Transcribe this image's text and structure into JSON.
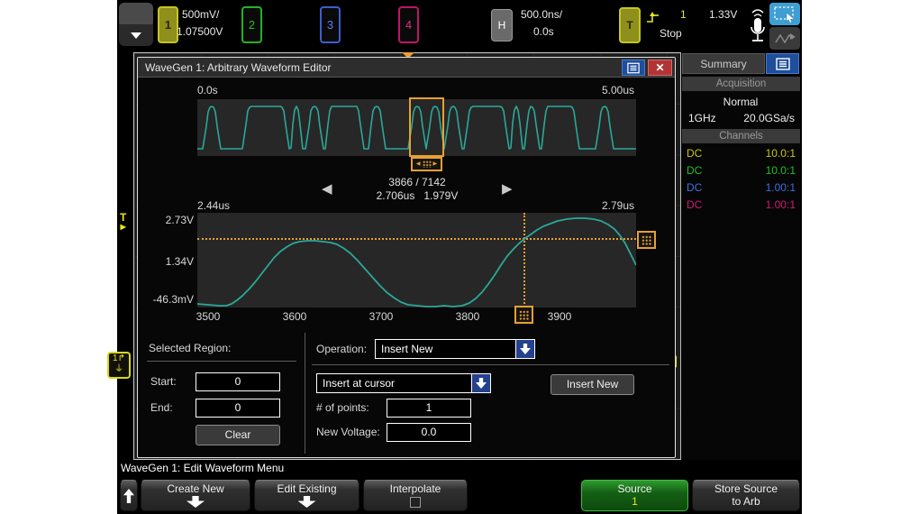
{
  "top_bar": {
    "ch1_label": "1",
    "ch1_scale": "500mV/",
    "ch1_offset": "1.07500V",
    "ch2_label": "2",
    "ch3_label": "3",
    "ch4_label": "4",
    "h_label": "H",
    "h_scale": "500.0ns/",
    "h_delay": "0.0s",
    "t_label": "T",
    "trigger_source": "1",
    "run_state": "Stop",
    "trigger_level": "1.33V"
  },
  "dialog": {
    "title": "WaveGen 1: Arbitrary Waveform Editor",
    "close_label": "✕",
    "overview": {
      "start_label": "0.0s",
      "end_label": "5.00us"
    },
    "nav": {
      "position": "3866 / 7142",
      "time": "2.706us",
      "voltage": "1.979V",
      "prev": "◀",
      "next": "▶"
    },
    "zoom": {
      "start_label": "2.44us",
      "end_label": "2.79us",
      "y_ticks": [
        "2.73V",
        "1.34V",
        "-46.3mV"
      ],
      "x_ticks": [
        "3500",
        "3600",
        "3700",
        "3800",
        "3900"
      ]
    },
    "region": {
      "heading": "Selected Region:",
      "start_label": "Start:",
      "start_value": "0",
      "end_label": "End:",
      "end_value": "0",
      "clear_label": "Clear"
    },
    "op": {
      "label": "Operation:",
      "value": "Insert New",
      "mode_value": "Insert at cursor",
      "points_label": "# of points:",
      "points_value": "1",
      "voltage_label": "New Voltage:",
      "voltage_value": "0.0",
      "action_label": "Insert New"
    }
  },
  "sidebar": {
    "tab": "Summary",
    "acq_header": "Acquisition",
    "acq_mode": "Normal",
    "bandwidth": "1GHz",
    "sample_rate": "20.0GSa/s",
    "ch_header": "Channels",
    "channels": [
      {
        "coupling": "DC",
        "probe": "10.0:1",
        "color": "#c8c814"
      },
      {
        "coupling": "DC",
        "probe": "10.0:1",
        "color": "#22c022"
      },
      {
        "coupling": "DC",
        "probe": "1.00:1",
        "color": "#4070e0"
      },
      {
        "coupling": "DC",
        "probe": "1.00:1",
        "color": "#d01878"
      }
    ]
  },
  "menu": {
    "status": "WaveGen 1: Edit Waveform Menu",
    "create_label": "Create New",
    "edit_label": "Edit Existing",
    "interpolate_label": "Interpolate",
    "source_label": "Source",
    "source_value": "1",
    "store_line1": "Store Source",
    "store_line2": "to Arb"
  },
  "colors": {
    "waveform": "#2aa89a",
    "accent_orange": "#e8a030",
    "ch1": "#c8c814",
    "ch2": "#22c022",
    "ch3": "#4070e0",
    "ch4": "#d01878",
    "menu_button_blue": "#1e4e9c",
    "close_red": "#b23434",
    "source_green": "#156015"
  },
  "waveforms": {
    "overview": [
      [
        0,
        55
      ],
      [
        6,
        55
      ],
      [
        10,
        30
      ],
      [
        12,
        14
      ],
      [
        14,
        9
      ],
      [
        16,
        8
      ],
      [
        18,
        9
      ],
      [
        20,
        14
      ],
      [
        22,
        30
      ],
      [
        26,
        55
      ],
      [
        50,
        55
      ],
      [
        54,
        28
      ],
      [
        56,
        13
      ],
      [
        58,
        9
      ],
      [
        60,
        8
      ],
      [
        92,
        8
      ],
      [
        94,
        9
      ],
      [
        96,
        13
      ],
      [
        98,
        28
      ],
      [
        102,
        55
      ],
      [
        104,
        54
      ],
      [
        106,
        28
      ],
      [
        108,
        12
      ],
      [
        110,
        8
      ],
      [
        112,
        12
      ],
      [
        114,
        28
      ],
      [
        117,
        55
      ],
      [
        120,
        55
      ],
      [
        124,
        30
      ],
      [
        126,
        13
      ],
      [
        128,
        9
      ],
      [
        130,
        8
      ],
      [
        132,
        9
      ],
      [
        134,
        13
      ],
      [
        136,
        30
      ],
      [
        140,
        55
      ],
      [
        142,
        55
      ],
      [
        145,
        28
      ],
      [
        147,
        13
      ],
      [
        149,
        8
      ],
      [
        177,
        8
      ],
      [
        179,
        13
      ],
      [
        181,
        28
      ],
      [
        185,
        55
      ],
      [
        190,
        55
      ],
      [
        193,
        28
      ],
      [
        195,
        13
      ],
      [
        197,
        9
      ],
      [
        199,
        8
      ],
      [
        201,
        9
      ],
      [
        203,
        13
      ],
      [
        205,
        28
      ],
      [
        209,
        55
      ],
      [
        234,
        55
      ],
      [
        238,
        30
      ],
      [
        240,
        14
      ],
      [
        242,
        9
      ],
      [
        244,
        8
      ],
      [
        246,
        9
      ],
      [
        248,
        14
      ],
      [
        250,
        30
      ],
      [
        254,
        55
      ],
      [
        258,
        30
      ],
      [
        260,
        14
      ],
      [
        262,
        9
      ],
      [
        264,
        8
      ],
      [
        266,
        9
      ],
      [
        268,
        14
      ],
      [
        270,
        30
      ],
      [
        274,
        55
      ],
      [
        278,
        30
      ],
      [
        280,
        14
      ],
      [
        282,
        9
      ],
      [
        284,
        8
      ],
      [
        286,
        9
      ],
      [
        288,
        14
      ],
      [
        290,
        30
      ],
      [
        294,
        55
      ],
      [
        296,
        55
      ],
      [
        300,
        28
      ],
      [
        302,
        13
      ],
      [
        304,
        9
      ],
      [
        306,
        8
      ],
      [
        336,
        8
      ],
      [
        338,
        9
      ],
      [
        340,
        13
      ],
      [
        342,
        28
      ],
      [
        346,
        55
      ],
      [
        348,
        54
      ],
      [
        350,
        26
      ],
      [
        352,
        12
      ],
      [
        354,
        8
      ],
      [
        356,
        12
      ],
      [
        358,
        26
      ],
      [
        361,
        55
      ],
      [
        363,
        55
      ],
      [
        366,
        28
      ],
      [
        368,
        13
      ],
      [
        370,
        8
      ],
      [
        372,
        9
      ],
      [
        374,
        13
      ],
      [
        376,
        28
      ],
      [
        380,
        55
      ],
      [
        382,
        55
      ],
      [
        385,
        28
      ],
      [
        387,
        13
      ],
      [
        389,
        8
      ],
      [
        414,
        8
      ],
      [
        416,
        9
      ],
      [
        418,
        13
      ],
      [
        420,
        28
      ],
      [
        424,
        55
      ],
      [
        442,
        55
      ],
      [
        446,
        30
      ],
      [
        448,
        14
      ],
      [
        450,
        9
      ],
      [
        452,
        8
      ],
      [
        454,
        9
      ],
      [
        456,
        14
      ],
      [
        458,
        30
      ],
      [
        462,
        55
      ],
      [
        487,
        55
      ]
    ],
    "zoomed": [
      [
        0,
        101
      ],
      [
        12,
        102
      ],
      [
        24,
        103
      ],
      [
        32,
        103
      ],
      [
        38,
        101
      ],
      [
        44,
        97
      ],
      [
        50,
        92
      ],
      [
        57,
        85
      ],
      [
        64,
        77
      ],
      [
        71,
        68
      ],
      [
        78,
        59
      ],
      [
        85,
        50
      ],
      [
        92,
        43
      ],
      [
        99,
        38
      ],
      [
        106,
        34
      ],
      [
        113,
        32
      ],
      [
        122,
        31
      ],
      [
        131,
        31
      ],
      [
        140,
        32
      ],
      [
        148,
        33
      ],
      [
        155,
        35
      ],
      [
        162,
        39
      ],
      [
        170,
        45
      ],
      [
        178,
        53
      ],
      [
        186,
        62
      ],
      [
        194,
        71
      ],
      [
        202,
        80
      ],
      [
        210,
        88
      ],
      [
        218,
        94
      ],
      [
        226,
        99
      ],
      [
        234,
        102
      ],
      [
        244,
        103
      ],
      [
        254,
        104
      ],
      [
        264,
        104
      ],
      [
        274,
        103
      ],
      [
        284,
        104
      ],
      [
        294,
        103
      ],
      [
        302,
        100
      ],
      [
        309,
        95
      ],
      [
        316,
        88
      ],
      [
        323,
        79
      ],
      [
        330,
        69
      ],
      [
        337,
        58
      ],
      [
        344,
        48
      ],
      [
        351,
        40
      ],
      [
        357,
        34
      ],
      [
        363,
        29
      ],
      [
        370,
        24
      ],
      [
        377,
        19
      ],
      [
        384,
        15
      ],
      [
        392,
        12
      ],
      [
        400,
        9
      ],
      [
        410,
        7
      ],
      [
        420,
        6
      ],
      [
        430,
        6
      ],
      [
        440,
        7
      ],
      [
        448,
        9
      ],
      [
        456,
        13
      ],
      [
        463,
        18
      ],
      [
        469,
        25
      ],
      [
        475,
        34
      ],
      [
        480,
        44
      ],
      [
        484,
        52
      ],
      [
        487,
        58
      ]
    ]
  }
}
